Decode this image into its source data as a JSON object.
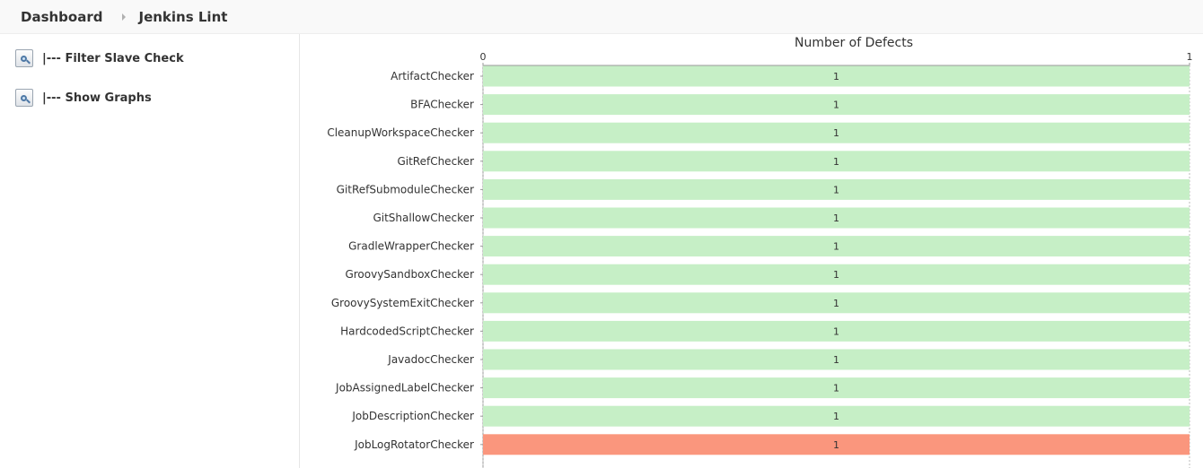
{
  "breadcrumb": {
    "items": [
      "Dashboard",
      "Jenkins Lint"
    ]
  },
  "sidebar": {
    "tasks": [
      {
        "label": "|--- Filter Slave Check",
        "icon": "search-icon"
      },
      {
        "label": "|--- Show Graphs",
        "icon": "search-icon"
      }
    ]
  },
  "colors": {
    "pass_bar": "#c6efc6",
    "fail_bar": "#fa967d"
  },
  "chart_data": {
    "type": "bar",
    "orientation": "horizontal",
    "title": "Number of Defects",
    "xlim": [
      0,
      1
    ],
    "xticks": [
      "0",
      "1"
    ],
    "categories": [
      "ArtifactChecker",
      "BFAChecker",
      "CleanupWorkspaceChecker",
      "GitRefChecker",
      "GitRefSubmoduleChecker",
      "GitShallowChecker",
      "GradleWrapperChecker",
      "GroovySandboxChecker",
      "GroovySystemExitChecker",
      "HardcodedScriptChecker",
      "JavadocChecker",
      "JobAssignedLabelChecker",
      "JobDescriptionChecker",
      "JobLogRotatorChecker"
    ],
    "values": [
      1,
      1,
      1,
      1,
      1,
      1,
      1,
      1,
      1,
      1,
      1,
      1,
      1,
      1
    ],
    "status": [
      "pass",
      "pass",
      "pass",
      "pass",
      "pass",
      "pass",
      "pass",
      "pass",
      "pass",
      "pass",
      "pass",
      "pass",
      "pass",
      "fail"
    ],
    "data_labels": [
      "1",
      "1",
      "1",
      "1",
      "1",
      "1",
      "1",
      "1",
      "1",
      "1",
      "1",
      "1",
      "1",
      "1"
    ],
    "grid": true
  }
}
